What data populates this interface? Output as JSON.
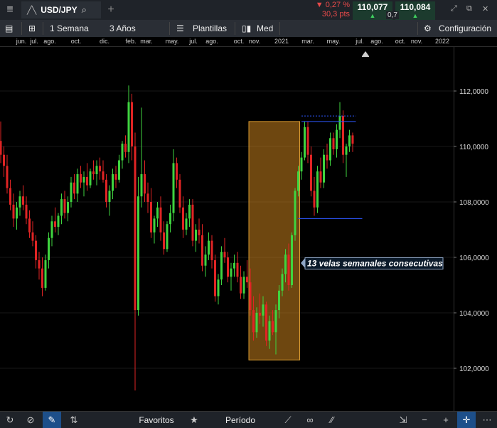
{
  "topbar": {
    "symbol": "USD/JPY",
    "change_pct": "▼ 0,27 %",
    "change_pts": "30,3 pts",
    "sell_price": "110,077",
    "buy_price": "110,084",
    "spread": "0,7"
  },
  "toolbar": {
    "interval": "1 Semana",
    "range": "3 Años",
    "templates": "Plantillas",
    "price_type": "Med",
    "settings": "Configuración"
  },
  "bottombar": {
    "favorites": "Favoritos",
    "period": "Período"
  },
  "colors": {
    "bull": "#3fd43f",
    "bear": "#e02424",
    "highlight": "#c8821e",
    "line": "#2e58ff",
    "annotation_bg": "#0b1a2a",
    "annotation_border": "#8fa6c6"
  },
  "chart_data": {
    "type": "candlestick",
    "time_labels": [
      "jun.",
      "jul.",
      "ago.",
      "oct.",
      "dic.",
      "feb.",
      "mar.",
      "may.",
      "jul.",
      "ago.",
      "oct.",
      "nov.",
      "2021",
      "mar.",
      "may.",
      "jul.",
      "ago.",
      "oct.",
      "nov.",
      "2022"
    ],
    "y_labels": [
      "112,0000",
      "110,0000",
      "108,0000",
      "106,0000",
      "104,0000",
      "102,0000"
    ],
    "ylim": [
      101.6,
      113.3
    ],
    "annotation": "13 velas semanales consecutivas",
    "candles": [
      [
        110.2,
        110.9,
        109.4,
        109.7
      ],
      [
        109.7,
        110.0,
        108.9,
        109.3
      ],
      [
        109.3,
        109.7,
        108.3,
        108.5
      ],
      [
        108.5,
        108.8,
        107.7,
        107.9
      ],
      [
        107.9,
        108.3,
        107.1,
        107.4
      ],
      [
        107.4,
        108.0,
        107.0,
        107.8
      ],
      [
        107.8,
        108.4,
        107.5,
        108.2
      ],
      [
        108.2,
        108.6,
        107.7,
        107.9
      ],
      [
        107.9,
        108.2,
        107.2,
        107.4
      ],
      [
        107.4,
        107.7,
        106.7,
        106.9
      ],
      [
        106.9,
        107.3,
        106.4,
        106.6
      ],
      [
        106.6,
        106.8,
        105.6,
        105.9
      ],
      [
        105.9,
        106.2,
        105.2,
        105.6
      ],
      [
        105.6,
        106.0,
        104.6,
        104.9
      ],
      [
        104.9,
        106.1,
        104.8,
        105.9
      ],
      [
        105.9,
        106.9,
        105.6,
        106.7
      ],
      [
        106.7,
        107.5,
        106.4,
        107.3
      ],
      [
        107.3,
        107.8,
        106.9,
        107.1
      ],
      [
        107.1,
        107.6,
        106.8,
        107.5
      ],
      [
        107.5,
        108.3,
        107.2,
        108.1
      ],
      [
        108.1,
        108.4,
        107.4,
        107.6
      ],
      [
        107.6,
        108.2,
        107.3,
        108.0
      ],
      [
        108.0,
        108.9,
        107.8,
        108.7
      ],
      [
        108.7,
        109.0,
        108.1,
        108.3
      ],
      [
        108.3,
        109.2,
        108.0,
        109.0
      ],
      [
        109.0,
        109.3,
        108.5,
        108.7
      ],
      [
        108.7,
        109.1,
        108.2,
        108.9
      ],
      [
        108.9,
        109.4,
        108.4,
        108.6
      ],
      [
        108.6,
        109.2,
        108.5,
        109.1
      ],
      [
        109.1,
        109.5,
        108.8,
        109.0
      ],
      [
        109.0,
        109.5,
        108.6,
        109.3
      ],
      [
        109.3,
        109.6,
        108.8,
        109.1
      ],
      [
        109.1,
        109.5,
        108.7,
        108.8
      ],
      [
        108.8,
        109.0,
        107.8,
        108.0
      ],
      [
        108.0,
        108.6,
        107.5,
        108.4
      ],
      [
        108.4,
        109.2,
        108.1,
        109.0
      ],
      [
        109.0,
        109.3,
        108.5,
        108.8
      ],
      [
        108.8,
        109.7,
        108.7,
        109.5
      ],
      [
        109.5,
        110.2,
        109.2,
        110.1
      ],
      [
        110.1,
        110.4,
        109.6,
        109.8
      ],
      [
        109.8,
        112.2,
        109.4,
        111.6
      ],
      [
        111.6,
        111.9,
        109.5,
        110.0
      ],
      [
        110.0,
        110.5,
        101.2,
        104.1
      ],
      [
        104.1,
        108.9,
        103.9,
        108.2
      ],
      [
        108.2,
        111.4,
        107.8,
        109.0
      ],
      [
        109.0,
        109.5,
        108.0,
        108.3
      ],
      [
        108.3,
        108.7,
        107.6,
        108.0
      ],
      [
        108.0,
        108.5,
        106.7,
        106.9
      ],
      [
        106.9,
        107.5,
        106.5,
        107.4
      ],
      [
        107.4,
        108.0,
        107.1,
        107.8
      ],
      [
        107.8,
        108.2,
        106.6,
        106.9
      ],
      [
        106.9,
        107.3,
        106.1,
        106.3
      ],
      [
        106.3,
        107.3,
        106.2,
        107.2
      ],
      [
        107.2,
        107.9,
        106.9,
        107.6
      ],
      [
        107.6,
        109.9,
        107.3,
        109.4
      ],
      [
        109.4,
        109.6,
        108.5,
        108.8
      ],
      [
        108.8,
        109.0,
        107.6,
        107.8
      ],
      [
        107.8,
        108.2,
        106.7,
        107.0
      ],
      [
        107.0,
        107.6,
        106.8,
        107.4
      ],
      [
        107.4,
        108.1,
        107.1,
        107.9
      ],
      [
        107.9,
        108.1,
        106.4,
        106.6
      ],
      [
        106.6,
        107.2,
        106.2,
        107.0
      ],
      [
        107.0,
        107.4,
        106.5,
        106.8
      ],
      [
        106.8,
        107.2,
        105.5,
        105.7
      ],
      [
        105.7,
        106.4,
        105.3,
        106.1
      ],
      [
        106.1,
        106.9,
        105.9,
        106.6
      ],
      [
        106.6,
        106.8,
        105.6,
        105.9
      ],
      [
        105.9,
        106.1,
        104.4,
        104.6
      ],
      [
        104.6,
        105.4,
        104.3,
        105.2
      ],
      [
        105.2,
        106.4,
        105.0,
        106.2
      ],
      [
        106.2,
        106.7,
        105.8,
        106.0
      ],
      [
        106.0,
        106.2,
        105.1,
        105.3
      ],
      [
        105.3,
        105.8,
        104.8,
        105.6
      ],
      [
        105.6,
        106.1,
        105.3,
        105.8
      ],
      [
        105.8,
        106.2,
        105.1,
        105.3
      ],
      [
        105.3,
        105.7,
        104.5,
        104.7
      ],
      [
        104.7,
        105.5,
        104.5,
        105.3
      ],
      [
        105.3,
        105.9,
        104.9,
        105.1
      ],
      [
        105.1,
        105.6,
        103.9,
        104.1
      ],
      [
        104.1,
        104.6,
        103.0,
        103.3
      ],
      [
        103.3,
        104.2,
        103.1,
        104.0
      ],
      [
        104.0,
        104.7,
        103.6,
        103.9
      ],
      [
        103.9,
        104.6,
        103.5,
        104.3
      ],
      [
        104.3,
        104.4,
        102.8,
        103.0
      ],
      [
        103.0,
        103.9,
        102.7,
        103.7
      ],
      [
        103.7,
        104.1,
        103.2,
        103.3
      ],
      [
        103.3,
        104.3,
        102.5,
        104.1
      ],
      [
        104.1,
        105.0,
        103.8,
        104.8
      ],
      [
        104.8,
        105.6,
        104.6,
        105.4
      ],
      [
        105.4,
        106.3,
        105.1,
        106.1
      ],
      [
        106.1,
        106.5,
        104.8,
        105.0
      ],
      [
        105.0,
        106.9,
        104.9,
        106.8
      ],
      [
        106.8,
        108.5,
        106.6,
        108.4
      ],
      [
        108.4,
        109.3,
        108.2,
        109.1
      ],
      [
        109.1,
        109.8,
        108.8,
        109.6
      ],
      [
        109.6,
        110.9,
        109.5,
        110.7
      ],
      [
        110.7,
        110.9,
        109.4,
        109.7
      ],
      [
        109.7,
        110.0,
        108.2,
        108.4
      ],
      [
        108.4,
        108.9,
        107.5,
        107.8
      ],
      [
        107.8,
        109.3,
        107.6,
        109.1
      ],
      [
        109.1,
        109.6,
        108.5,
        108.7
      ],
      [
        108.7,
        109.9,
        108.5,
        109.7
      ],
      [
        109.7,
        110.1,
        109.2,
        109.5
      ],
      [
        109.5,
        110.5,
        109.3,
        110.3
      ],
      [
        110.3,
        110.5,
        109.7,
        109.9
      ],
      [
        109.9,
        110.8,
        109.6,
        110.6
      ],
      [
        110.6,
        111.6,
        110.3,
        111.1
      ],
      [
        111.1,
        111.3,
        109.4,
        109.7
      ],
      [
        109.7,
        110.1,
        108.9,
        110.0
      ],
      [
        110.0,
        110.6,
        109.8,
        110.4
      ],
      [
        110.4,
        110.5,
        109.8,
        110.1
      ]
    ],
    "highlight": {
      "from_index": 78,
      "to_index": 93,
      "low": 102.3,
      "high": 110.9
    },
    "hlines": [
      {
        "value": 111.1,
        "style": "dotted",
        "from_index": 94,
        "to_index": 111
      },
      {
        "value": 110.9,
        "style": "solid",
        "from_index": 94,
        "to_index": 111
      },
      {
        "value": 107.4,
        "style": "solid",
        "from_index": 93,
        "to_index": 113
      }
    ]
  }
}
